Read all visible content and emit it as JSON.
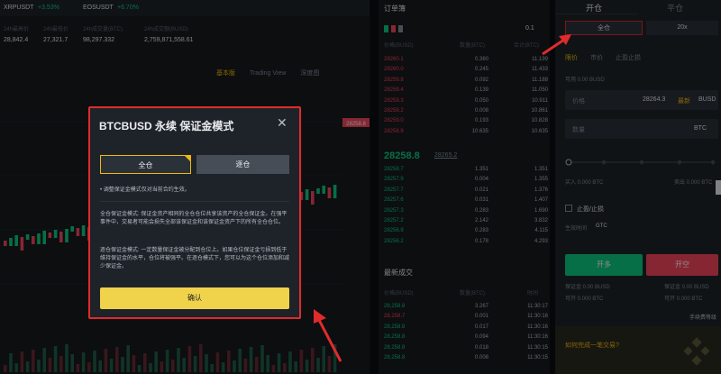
{
  "ticker": [
    {
      "symbol": "XRPUSDT",
      "change": "+3.53%"
    },
    {
      "symbol": "EOSUSDT",
      "change": "+6.70%"
    }
  ],
  "stats": [
    {
      "label": "24h最高价",
      "value": "28,842.4"
    },
    {
      "label": "24h最低价",
      "value": "27,321.7"
    },
    {
      "label": "24h成交量(BTC)",
      "value": "98,297.332"
    },
    {
      "label": "24h成交额(BUSD)",
      "value": "2,759,871,558.61"
    }
  ],
  "chart_tabs": [
    "基本版",
    "Trading View",
    "深度图"
  ],
  "chart_price_tag": "28258.8",
  "orderbook": {
    "title": "订单簿",
    "precision": "0.1",
    "headers": [
      "价格(BUSD)",
      "数量(BTC)",
      "合计(BTC)"
    ],
    "asks": [
      [
        "28260.1",
        "0.360",
        "11.199"
      ],
      [
        "28260.0",
        "0.245",
        "11.433"
      ],
      [
        "28259.8",
        "0.092",
        "11.188"
      ],
      [
        "28259.4",
        "0.139",
        "11.050"
      ],
      [
        "28259.3",
        "0.050",
        "10.911"
      ],
      [
        "28259.2",
        "0.008",
        "10.861"
      ],
      [
        "28259.0",
        "0.193",
        "10.828"
      ],
      [
        "28258.9",
        "10.635",
        "10.635"
      ]
    ],
    "mid_price": "28258.8",
    "mark_price": "28265.2",
    "bids": [
      [
        "28258.7",
        "1.351",
        "1.351"
      ],
      [
        "28257.9",
        "0.004",
        "1.355"
      ],
      [
        "28257.7",
        "0.021",
        "1.376"
      ],
      [
        "28257.6",
        "0.031",
        "1.407"
      ],
      [
        "28257.3",
        "0.283",
        "1.690"
      ],
      [
        "28257.2",
        "2.142",
        "3.832"
      ],
      [
        "28256.9",
        "0.283",
        "4.115"
      ],
      [
        "28256.2",
        "0.178",
        "4.293"
      ]
    ]
  },
  "trades": {
    "title": "最新成交",
    "headers": [
      "价格(BUSD)",
      "数量(BTC)",
      "时间"
    ],
    "rows": [
      [
        "28,258.8",
        "3.267",
        "11:30:17"
      ],
      [
        "28,258.7",
        "0.001",
        "11:30:16"
      ],
      [
        "28,258.8",
        "0.017",
        "11:30:16"
      ],
      [
        "28,258.8",
        "0.094",
        "11:30:16"
      ],
      [
        "28,258.8",
        "0.018",
        "11:30:15"
      ],
      [
        "28,258.8",
        "0.008",
        "11:30:15"
      ]
    ]
  },
  "panel": {
    "tab_open": "开仓",
    "tab_close": "平仓",
    "margin_mode": "全仓",
    "leverage": "20x",
    "order_types": [
      "限价",
      "市价",
      "止盈止损"
    ],
    "available": "可用 0.00 BUSD",
    "price_label": "价格",
    "price_value": "28264.3",
    "latest": "最新",
    "currency": "BUSD",
    "qty_label": "数量",
    "qty_unit": "BTC",
    "buy_info": "买入 0.000 BTC",
    "sell_info": "卖出 0.000 BTC",
    "tp_sl": "止盈/止损",
    "tif_label": "生效时间",
    "tif_value": "GTC",
    "buy_label": "开多",
    "sell_label": "开空",
    "margin_buy": "保证金 0.00 BUSD",
    "margin_sell": "保证金 0.00 BUSD",
    "cost_buy": "可开 0.000 BTC",
    "cost_sell": "可开 0.000 BTC",
    "fee_link": "手续费等级",
    "promo": "如何完成一笔交易?"
  },
  "modal": {
    "title": "BTCBUSD 永续 保证金模式",
    "cross": "全仓",
    "isolated": "逐仓",
    "note": "• 调整保证金模式仅对当前合约生效。",
    "cross_desc": "全仓保证金模式: 保证金资产相同的全仓仓位共享该资产的全仓保证金。在强平事件中，交易者可能会损失全部该保证金和该保证金资产下的所有全仓仓位。",
    "isolated_desc": "逐仓保证金模式: 一定数量保证金被分配到仓位上。如果仓位保证金亏损到低于维持保证金的水平，仓位将被强平。在逐仓模式下，您可以为这个仓位添加和减少保证金。",
    "confirm": "确认"
  },
  "colors": {
    "up": "#0ecb81",
    "down": "#f6465d",
    "accent": "#f0b90b",
    "highlight": "#e02b2b"
  }
}
